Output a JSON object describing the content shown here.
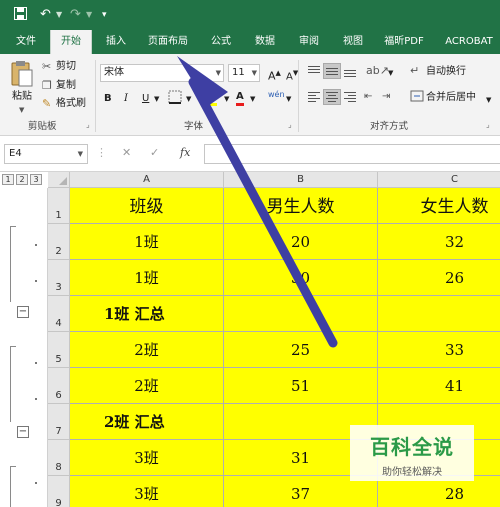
{
  "quick_access": {
    "save_icon": "save-icon",
    "undo_icon": "undo-icon",
    "redo_icon": "redo-icon",
    "customize_icon": "customize-icon"
  },
  "tabs": [
    {
      "label": "文件"
    },
    {
      "label": "开始",
      "active": true
    },
    {
      "label": "插入"
    },
    {
      "label": "页面布局"
    },
    {
      "label": "公式"
    },
    {
      "label": "数据"
    },
    {
      "label": "审阅"
    },
    {
      "label": "视图"
    },
    {
      "label": "福昕PDF"
    },
    {
      "label": "ACROBAT"
    }
  ],
  "ribbon": {
    "clipboard": {
      "paste": "粘贴",
      "cut": "剪切",
      "copy": "复制",
      "format_painter": "格式刷",
      "group_label": "剪贴板"
    },
    "font": {
      "font_name": "宋体",
      "font_size": "11",
      "bold": "B",
      "italic": "I",
      "underline": "U",
      "font_color": "A",
      "phonetic": "wén",
      "group_label": "字体"
    },
    "alignment": {
      "wrap_text": "自动换行",
      "merge_center": "合并后居中",
      "group_label": "对齐方式"
    }
  },
  "formula_bar": {
    "name_box": "E4",
    "cancel": "✕",
    "enter": "✓",
    "fx": "fx",
    "formula": ""
  },
  "outline_levels": [
    "1",
    "2",
    "3"
  ],
  "columns": [
    "A",
    "B",
    "C"
  ],
  "rows": [
    {
      "num": "1",
      "cells": [
        "班级",
        "男生人数",
        "女生人数"
      ]
    },
    {
      "num": "2",
      "cells": [
        "1班",
        "20",
        "32"
      ]
    },
    {
      "num": "3",
      "cells": [
        "1班",
        "30",
        "26"
      ]
    },
    {
      "num": "4",
      "cells": [
        "1班 汇总",
        "",
        ""
      ],
      "subtotal": true
    },
    {
      "num": "5",
      "cells": [
        "2班",
        "25",
        "33"
      ]
    },
    {
      "num": "6",
      "cells": [
        "2班",
        "51",
        "41"
      ]
    },
    {
      "num": "7",
      "cells": [
        "2班 汇总",
        "",
        ""
      ],
      "subtotal": true
    },
    {
      "num": "8",
      "cells": [
        "3班",
        "31",
        ""
      ]
    },
    {
      "num": "9",
      "cells": [
        "3班",
        "37",
        "28"
      ]
    }
  ],
  "annotation": {
    "arrow_color": "#3e3fa3"
  },
  "watermark": {
    "title": "百科全说",
    "subtitle": "助你轻松解决"
  },
  "colors": {
    "excel_green": "#217346",
    "cell_fill": "#ffff00"
  }
}
